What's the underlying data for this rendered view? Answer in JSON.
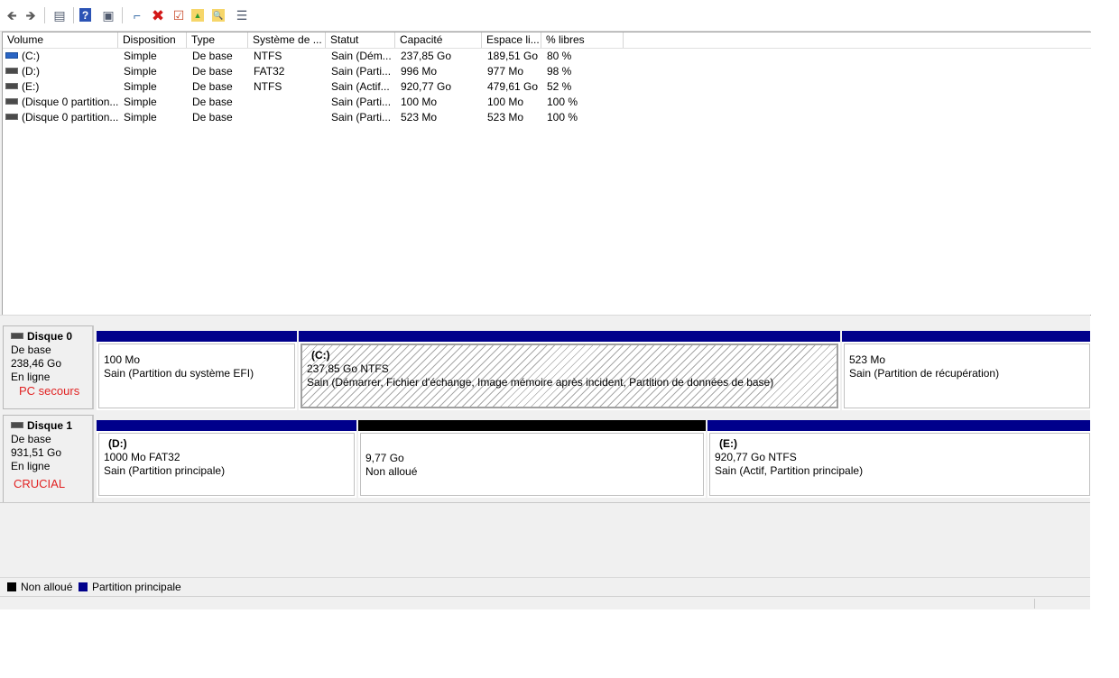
{
  "toolbar": {
    "buttons": [
      {
        "name": "back-button",
        "icon": "arrow-left-icon",
        "glyph": "🡸"
      },
      {
        "name": "forward-button",
        "icon": "arrow-right-icon",
        "glyph": "🡺"
      },
      {
        "name": "console-tree-button",
        "icon": "console-tree-icon",
        "glyph": "▤"
      },
      {
        "name": "help-button",
        "icon": "help-icon",
        "glyph": "?"
      },
      {
        "name": "properties-panel-button",
        "icon": "panel-icon",
        "glyph": "▣"
      },
      {
        "name": "connect-disk-button",
        "icon": "connect-icon",
        "glyph": "⌐"
      },
      {
        "name": "delete-button",
        "icon": "delete-icon",
        "glyph": "✖"
      },
      {
        "name": "check-button",
        "icon": "checklist-icon",
        "glyph": "☑"
      },
      {
        "name": "up-folder-button",
        "icon": "folder-up-icon",
        "glyph": "▲"
      },
      {
        "name": "search-folder-button",
        "icon": "folder-search-icon",
        "glyph": "🔍"
      },
      {
        "name": "properties-button",
        "icon": "properties-icon",
        "glyph": "☰"
      }
    ]
  },
  "volume_list": {
    "columns": [
      "Volume",
      "Disposition",
      "Type",
      "Système de ...",
      "Statut",
      "Capacité",
      "Espace li...",
      "% libres"
    ],
    "rows": [
      {
        "icon": "disk-blue-icon",
        "volume": "(C:)",
        "disposition": "Simple",
        "type": "De base",
        "fs": "NTFS",
        "statut": "Sain (Dém...",
        "capacite": "237,85 Go",
        "espace": "189,51 Go",
        "libres": "80 %"
      },
      {
        "icon": "disk-icon",
        "volume": "(D:)",
        "disposition": "Simple",
        "type": "De base",
        "fs": "FAT32",
        "statut": "Sain (Parti...",
        "capacite": "996 Mo",
        "espace": "977 Mo",
        "libres": "98 %"
      },
      {
        "icon": "disk-icon",
        "volume": "(E:)",
        "disposition": "Simple",
        "type": "De base",
        "fs": "NTFS",
        "statut": "Sain (Actif...",
        "capacite": "920,77 Go",
        "espace": "479,61 Go",
        "libres": "52 %"
      },
      {
        "icon": "disk-icon",
        "volume": "(Disque 0 partition...",
        "disposition": "Simple",
        "type": "De base",
        "fs": "",
        "statut": "Sain (Parti...",
        "capacite": "100 Mo",
        "espace": "100 Mo",
        "libres": "100 %"
      },
      {
        "icon": "disk-icon",
        "volume": "(Disque 0 partition...",
        "disposition": "Simple",
        "type": "De base",
        "fs": "",
        "statut": "Sain (Parti...",
        "capacite": "523 Mo",
        "espace": "523 Mo",
        "libres": "100 %"
      }
    ]
  },
  "disks": [
    {
      "name": "Disque 0",
      "kind": "De base",
      "size": "238,46 Go",
      "state": "En ligne",
      "note": "PC secours",
      "partitions": [
        {
          "label": "",
          "size": "100 Mo",
          "status": "Sain (Partition du système EFI)",
          "bar_color": "#00008b"
        },
        {
          "label": "(C:)",
          "size": "237,85 Go NTFS",
          "status": "Sain (Démarrer, Fichier d'échange, Image mémoire après incident, Partition de données de base)",
          "bar_color": "#00008b"
        },
        {
          "label": "",
          "size": "523 Mo",
          "status": "Sain (Partition de récupération)",
          "bar_color": "#00008b"
        }
      ]
    },
    {
      "name": "Disque 1",
      "kind": "De base",
      "size": "931,51 Go",
      "state": "En ligne",
      "note": "CRUCIAL",
      "partitions": [
        {
          "label": "(D:)",
          "size": "1000 Mo FAT32",
          "status": "Sain (Partition principale)",
          "bar_color": "#00008b"
        },
        {
          "label": "",
          "size": "9,77 Go",
          "status": "Non alloué",
          "bar_color": "#000000"
        },
        {
          "label": "(E:)",
          "size": "920,77 Go NTFS",
          "status": "Sain (Actif, Partition principale)",
          "bar_color": "#00008b"
        }
      ]
    }
  ],
  "legend": {
    "items": [
      {
        "label": "Non alloué",
        "color": "#000000"
      },
      {
        "label": "Partition principale",
        "color": "#00008b"
      }
    ]
  }
}
